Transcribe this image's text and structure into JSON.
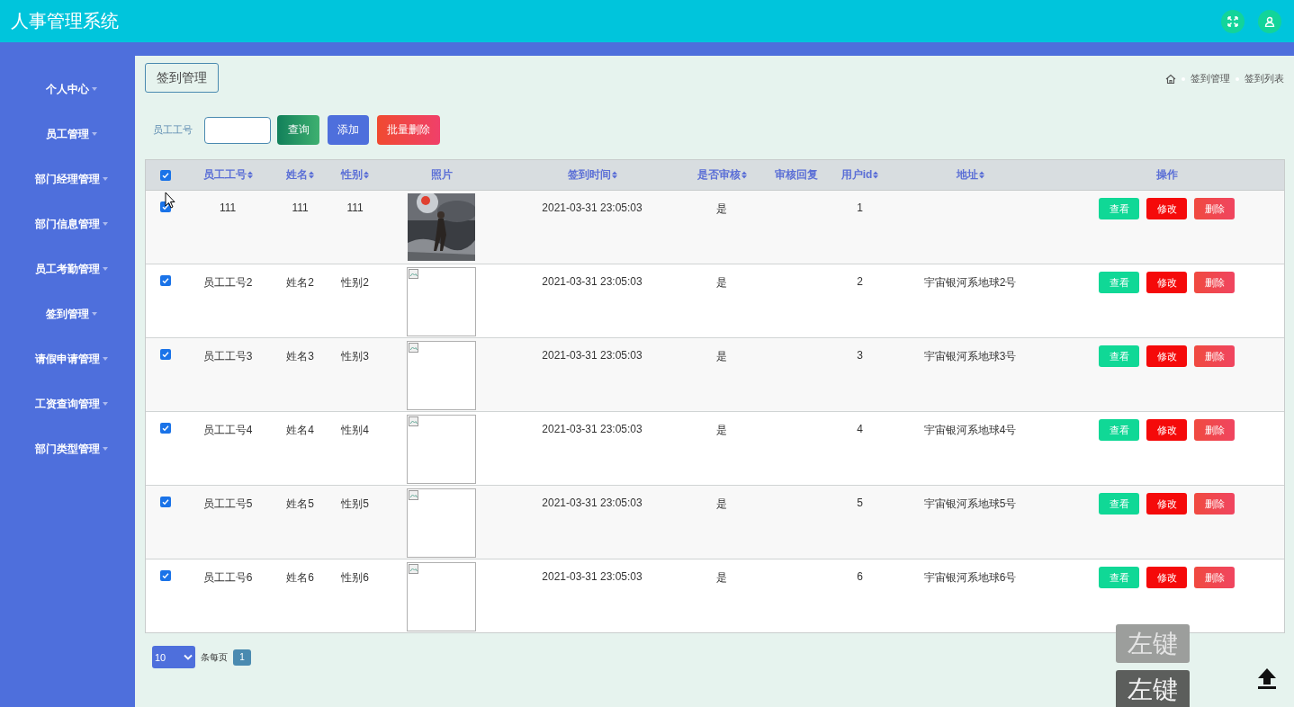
{
  "header": {
    "title": "人事管理系统"
  },
  "sidebar": {
    "items": [
      {
        "label": "个人中心"
      },
      {
        "label": "员工管理"
      },
      {
        "label": "部门经理管理"
      },
      {
        "label": "部门信息管理"
      },
      {
        "label": "员工考勤管理"
      },
      {
        "label": "签到管理"
      },
      {
        "label": "请假申请管理"
      },
      {
        "label": "工资查询管理"
      },
      {
        "label": "部门类型管理"
      }
    ]
  },
  "page_title": "签到管理",
  "breadcrumb": [
    "签到管理",
    "签到列表"
  ],
  "search": {
    "label": "员工工号",
    "buttons": [
      {
        "label": "查询",
        "kind": "query"
      },
      {
        "label": "添加",
        "kind": "add"
      },
      {
        "label": "批量删除",
        "kind": "delete"
      }
    ]
  },
  "table": {
    "all_checked": true,
    "columns": [
      {
        "label": "员工工号",
        "sortable": true
      },
      {
        "label": "姓名",
        "sortable": true
      },
      {
        "label": "性别",
        "sortable": true
      },
      {
        "label": "照片",
        "sortable": false
      },
      {
        "label": "签到时间",
        "sortable": true
      },
      {
        "label": "是否审核",
        "sortable": true
      },
      {
        "label": "审核回复",
        "sortable": false
      },
      {
        "label": "用户id",
        "sortable": true
      },
      {
        "label": "地址",
        "sortable": true
      },
      {
        "label": "操作",
        "sortable": false
      }
    ],
    "rows": [
      {
        "checked": true,
        "emp_no": "111",
        "name": "111",
        "gender": "111",
        "time": "2021-03-31 23:05:03",
        "reviewed": "是",
        "user_id": "1",
        "actions": [
          {
            "label": "查看",
            "kind": "view"
          },
          {
            "label": "修改",
            "kind": "edit"
          },
          {
            "label": "删除",
            "kind": "delete"
          }
        ]
      },
      {
        "checked": true,
        "emp_no": "员工工号2",
        "name": "姓名2",
        "gender": "性别2",
        "photo": {
          "kind": "broken"
        },
        "time": "2021-03-31 23:05:03",
        "reviewed": "是",
        "user_id": "2",
        "address": "宇宙银河系地球2号",
        "actions": [
          {
            "label": "查看",
            "kind": "view"
          },
          {
            "label": "修改",
            "kind": "edit"
          },
          {
            "label": "删除",
            "kind": "delete"
          }
        ]
      },
      {
        "checked": true,
        "emp_no": "员工工号3",
        "name": "姓名3",
        "gender": "性别3",
        "photo": {
          "kind": "broken"
        },
        "time": "2021-03-31 23:05:03",
        "reviewed": "是",
        "user_id": "3",
        "address": "宇宙银河系地球3号",
        "actions": [
          {
            "label": "查看",
            "kind": "view"
          },
          {
            "label": "修改",
            "kind": "edit"
          },
          {
            "label": "删除",
            "kind": "delete"
          }
        ]
      },
      {
        "checked": true,
        "emp_no": "员工工号4",
        "name": "姓名4",
        "gender": "性别4",
        "photo": {
          "kind": "broken"
        },
        "time": "2021-03-31 23:05:03",
        "reviewed": "是",
        "user_id": "4",
        "address": "宇宙银河系地球4号",
        "actions": [
          {
            "label": "查看",
            "kind": "view"
          },
          {
            "label": "修改",
            "kind": "edit"
          },
          {
            "label": "删除",
            "kind": "delete"
          }
        ]
      },
      {
        "checked": true,
        "emp_no": "员工工号5",
        "name": "姓名5",
        "gender": "性别5",
        "photo": {
          "kind": "broken"
        },
        "time": "2021-03-31 23:05:03",
        "reviewed": "是",
        "user_id": "5",
        "address": "宇宙银河系地球5号",
        "actions": [
          {
            "label": "查看",
            "kind": "view"
          },
          {
            "label": "修改",
            "kind": "edit"
          },
          {
            "label": "删除",
            "kind": "delete"
          }
        ]
      },
      {
        "checked": true,
        "emp_no": "员工工号6",
        "name": "姓名6",
        "gender": "性别6",
        "photo": {
          "kind": "broken"
        },
        "time": "2021-03-31 23:05:03",
        "reviewed": "是",
        "user_id": "6",
        "address": "宇宙银河系地球6号",
        "actions": [
          {
            "label": "查看",
            "kind": "view"
          },
          {
            "label": "修改",
            "kind": "edit"
          },
          {
            "label": "删除",
            "kind": "delete"
          }
        ]
      }
    ]
  },
  "pagination": {
    "page_size": "10",
    "per_page_label": "条每页",
    "pages": [
      {
        "label": "1",
        "selected": true
      }
    ]
  },
  "key_overlays": [
    {
      "label": "左键",
      "kind": "light"
    },
    {
      "label": "左键",
      "kind": "dark"
    }
  ]
}
